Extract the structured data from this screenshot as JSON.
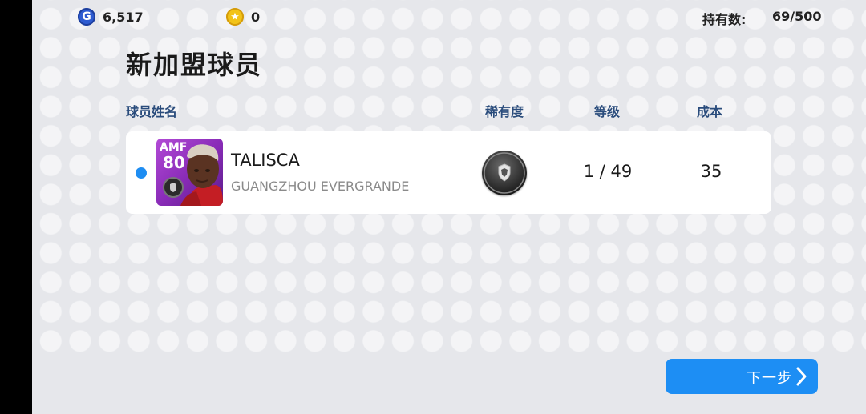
{
  "topbar": {
    "gp_icon": "gp-coin-icon",
    "gp_value": "6,517",
    "coin_icon": "star-coin-icon",
    "coin_value": "0",
    "holding_label": "持有数:",
    "holding_value": "69/500"
  },
  "page": {
    "title": "新加盟球员"
  },
  "columns": {
    "name": "球员姓名",
    "rarity": "稀有度",
    "level": "等级",
    "cost": "成本"
  },
  "player": {
    "new_indicator": "blue-dot-indicator",
    "position": "AMF",
    "rating": "80",
    "name": "TALISCA",
    "team": "GUANGZHOU EVERGRANDE",
    "rarity_icon": "black-ball-rarity-icon",
    "level": "1 / 49",
    "cost": "35"
  },
  "footer": {
    "next_label": "下一步",
    "next_icon": "chevron-right-icon"
  },
  "colors": {
    "accent": "#1d8ef4",
    "card_purple": "#8a2cb8",
    "header_text": "#2a4c7c"
  }
}
